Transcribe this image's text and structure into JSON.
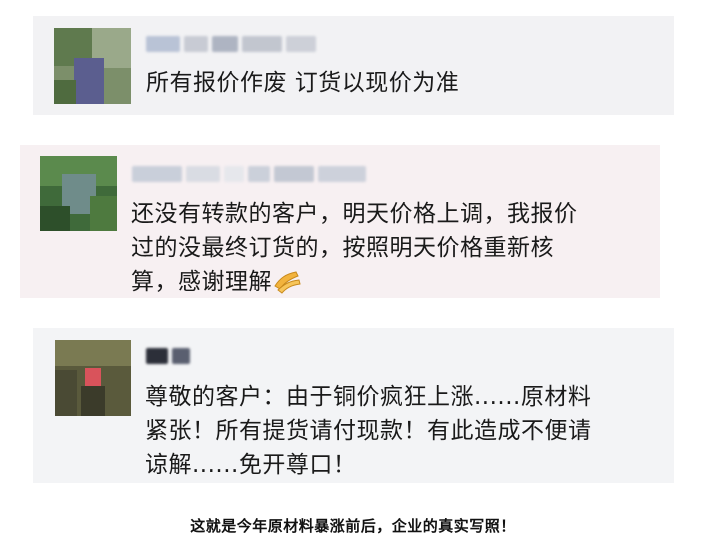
{
  "messages": [
    {
      "sender": "",
      "text": "所有报价作废 订货以现价为准"
    },
    {
      "sender": "",
      "lines": [
        "还没有转款的客户，明天价格上调，我报价",
        "过的没最终订货的，按照明天价格重新核",
        "算，感谢理解"
      ],
      "emoji": "clapping-hands"
    },
    {
      "sender": "",
      "lines": [
        "尊敬的客户：由于铜价疯狂上涨......原材料",
        "紧张！所有提货请付现款！有此造成不便请",
        "谅解......免开尊口！"
      ]
    }
  ],
  "caption": "这就是今年原材料暴涨前后，企业的真实写照！",
  "colors": {
    "card_1": "#f2f2f4",
    "card_2": "#f7f0f2",
    "card_3": "#f3f4f6",
    "text": "#1a1a1a"
  }
}
